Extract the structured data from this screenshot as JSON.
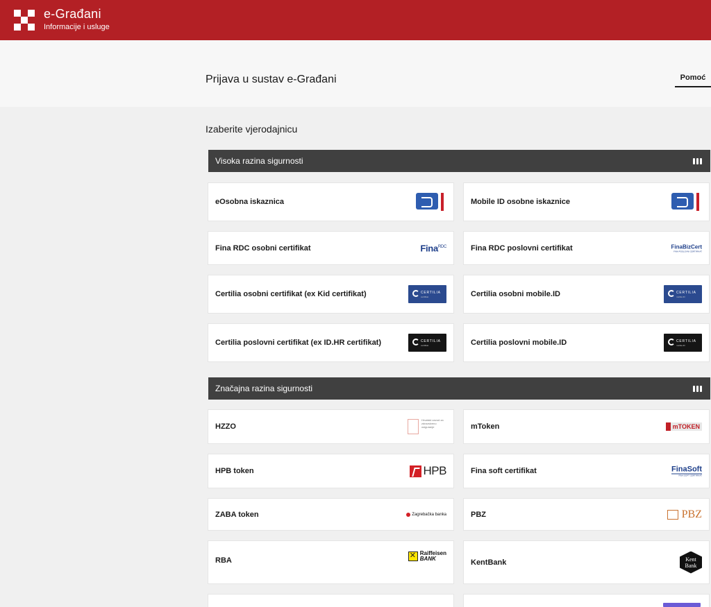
{
  "header": {
    "brand_title": "e-Građani",
    "brand_subtitle": "Informacije i usluge"
  },
  "page": {
    "title": "Prijava u sustav e-Građani",
    "help_link": "Pomoć",
    "choose_label": "Izaberite vjerodajnicu"
  },
  "sections": [
    {
      "title": "Visoka razina sigurnosti",
      "toggle_icon": "collapse-bars-icon",
      "items": [
        {
          "label": "eOsobna iskaznica",
          "logo": "eoi-logo"
        },
        {
          "label": "Mobile ID osobne iskaznice",
          "logo": "eoi-logo"
        },
        {
          "label": "Fina RDC osobni certifikat",
          "logo": "fina-rdc-logo",
          "logo_text": "Fina",
          "logo_sub": "RDC"
        },
        {
          "label": "Fina RDC poslovni certifikat",
          "logo": "fina-bizcert-logo",
          "logo_text": "FinaBizCert",
          "logo_sub": "FINA POSLOVNI CERTIFIKAT"
        },
        {
          "label": "Certilia osobni certifikat (ex Kid certifikat)",
          "logo": "certilia-blue-logo",
          "logo_text": "CERTILIA",
          "logo_sub": "certifikat"
        },
        {
          "label": "Certilia osobni mobile.ID",
          "logo": "certilia-blue-logo",
          "logo_text": "CERTILIA",
          "logo_sub": "mobile.ID"
        },
        {
          "label": "Certilia poslovni certifikat (ex ID.HR certifikat)",
          "logo": "certilia-black-logo",
          "logo_text": "CERTILIA",
          "logo_sub": "certifikat"
        },
        {
          "label": "Certilia poslovni mobile.ID",
          "logo": "certilia-black-logo",
          "logo_text": "CERTILIA",
          "logo_sub": "mobile.ID"
        }
      ]
    },
    {
      "title": "Značajna razina sigurnosti",
      "toggle_icon": "collapse-bars-icon",
      "items": [
        {
          "label": "HZZO",
          "logo": "hzzo-logo",
          "logo_text": "Hrvatski zavod za zdravstveno osiguranje"
        },
        {
          "label": "mToken",
          "logo": "mtoken-logo",
          "logo_text": "mTOKEN"
        },
        {
          "label": "HPB token",
          "logo": "hpb-logo",
          "logo_text": "HPB"
        },
        {
          "label": "Fina soft certifikat",
          "logo": "finasoft-logo",
          "logo_text": "FinaSoft",
          "logo_sub": "FINA SOFT CERTIFIKAT"
        },
        {
          "label": "ZABA token",
          "logo": "zaba-logo",
          "logo_text": "Zagrebačka banka"
        },
        {
          "label": "PBZ",
          "logo": "pbz-logo",
          "logo_text": "PBZ"
        },
        {
          "label": "RBA",
          "logo": "rba-logo",
          "logo_text": "Raiffeisen",
          "logo_sub": "BANK"
        },
        {
          "label": "KentBank",
          "logo": "kentbank-logo",
          "logo_text": "Kent Bank"
        }
      ]
    }
  ],
  "colors": {
    "brand_red": "#b32025",
    "section_bar": "#404040",
    "page_bg": "#f0f0f0"
  }
}
